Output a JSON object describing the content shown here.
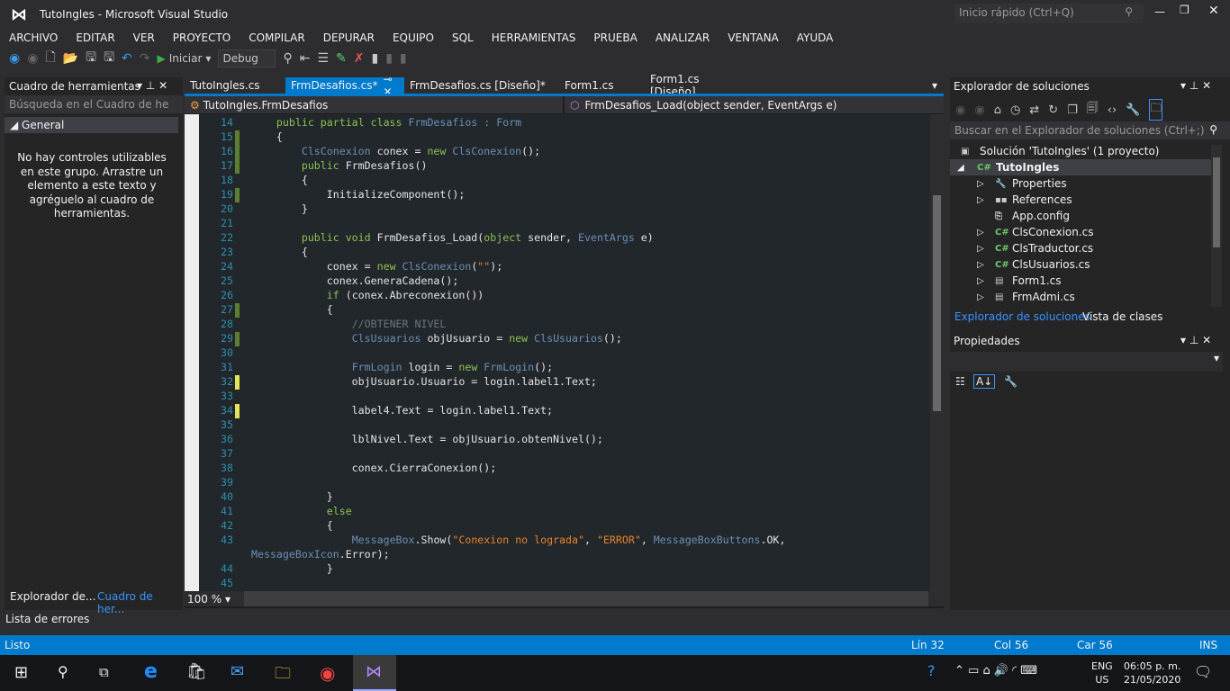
{
  "window": {
    "title": "TutoIngles - Microsoft Visual Studio",
    "quick_launch": "Inicio rápido (Ctrl+Q)"
  },
  "menu": [
    "ARCHIVO",
    "EDITAR",
    "VER",
    "PROYECTO",
    "COMPILAR",
    "DEPURAR",
    "EQUIPO",
    "SQL",
    "HERRAMIENTAS",
    "PRUEBA",
    "ANALIZAR",
    "VENTANA",
    "AYUDA"
  ],
  "toolbar": {
    "start_label": "Iniciar",
    "config": "Debug"
  },
  "toolbox": {
    "title": "Cuadro de herramientas",
    "search_placeholder": "Búsqueda en el Cuadro de he",
    "group": "General",
    "empty_message": "No hay controles utilizables en este grupo. Arrastre un elemento a este texto y agréguelo al cuadro de herramientas.",
    "bottom_tabs": [
      "Explorador de...",
      "Cuadro de her..."
    ]
  },
  "editor": {
    "tabs": [
      "TutoIngles.cs",
      "FrmDesafios.cs*",
      "FrmDesafios.cs [Diseño]*",
      "Form1.cs",
      "Form1.cs [Diseño]"
    ],
    "active_tab": 1,
    "nav_class": "TutoIngles.FrmDesafios",
    "nav_member": "FrmDesafios_Load(object sender, EventArgs e)",
    "zoom": "100 %",
    "lines": [
      {
        "n": "14",
        "tk": [
          [
            "    ",
            "p"
          ],
          [
            "public partial class ",
            "k"
          ],
          [
            "FrmDesafios : Form",
            "t"
          ]
        ]
      },
      {
        "n": "15",
        "tk": [
          [
            "    {",
            "p"
          ]
        ],
        "m": "g"
      },
      {
        "n": "16",
        "tk": [
          [
            "        ",
            "p"
          ],
          [
            "ClsConexion",
            "t"
          ],
          [
            " conex = ",
            "p"
          ],
          [
            "new ",
            "k"
          ],
          [
            "ClsConexion",
            "t"
          ],
          [
            "();",
            "p"
          ]
        ],
        "m": "g"
      },
      {
        "n": "17",
        "tk": [
          [
            "        ",
            "p"
          ],
          [
            "public ",
            "k"
          ],
          [
            "FrmDesafios()",
            "p"
          ]
        ],
        "m": "g"
      },
      {
        "n": "18",
        "tk": [
          [
            "        {",
            "p"
          ]
        ]
      },
      {
        "n": "19",
        "tk": [
          [
            "            InitializeComponent();",
            "p"
          ]
        ],
        "m": "g"
      },
      {
        "n": "20",
        "tk": [
          [
            "        }",
            "p"
          ]
        ]
      },
      {
        "n": "21",
        "tk": []
      },
      {
        "n": "22",
        "tk": [
          [
            "        ",
            "p"
          ],
          [
            "public void ",
            "k"
          ],
          [
            "FrmDesafios_Load(",
            "p"
          ],
          [
            "object ",
            "k"
          ],
          [
            "sender, ",
            "p"
          ],
          [
            "EventArgs",
            "t"
          ],
          [
            " e)",
            "p"
          ]
        ]
      },
      {
        "n": "23",
        "tk": [
          [
            "        {",
            "p"
          ]
        ]
      },
      {
        "n": "24",
        "tk": [
          [
            "            conex = ",
            "p"
          ],
          [
            "new ",
            "k"
          ],
          [
            "ClsConexion",
            "t"
          ],
          [
            "(",
            "p"
          ],
          [
            "\"\"",
            "s"
          ],
          [
            ");",
            "p"
          ]
        ]
      },
      {
        "n": "25",
        "tk": [
          [
            "            conex.GeneraCadena();",
            "p"
          ]
        ]
      },
      {
        "n": "26",
        "tk": [
          [
            "            ",
            "p"
          ],
          [
            "if ",
            "k"
          ],
          [
            "(conex.Abreconexion())",
            "p"
          ]
        ]
      },
      {
        "n": "27",
        "tk": [
          [
            "            {",
            "p"
          ]
        ],
        "m": "g"
      },
      {
        "n": "28",
        "tk": [
          [
            "                ",
            "p"
          ],
          [
            "//OBTENER NIVEL",
            "c"
          ]
        ]
      },
      {
        "n": "29",
        "tk": [
          [
            "                ",
            "p"
          ],
          [
            "ClsUsuarios",
            "t"
          ],
          [
            " objUsuario = ",
            "p"
          ],
          [
            "new ",
            "k"
          ],
          [
            "ClsUsuarios",
            "t"
          ],
          [
            "();",
            "p"
          ]
        ],
        "m": "g"
      },
      {
        "n": "30",
        "tk": []
      },
      {
        "n": "31",
        "tk": [
          [
            "                ",
            "p"
          ],
          [
            "FrmLogin",
            "t"
          ],
          [
            " login = ",
            "p"
          ],
          [
            "new ",
            "k"
          ],
          [
            "FrmLogin",
            "t"
          ],
          [
            "();",
            "p"
          ]
        ]
      },
      {
        "n": "32",
        "tk": [
          [
            "                objUsuario.Usuario = login.label1.Text;",
            "p"
          ]
        ],
        "m": "y"
      },
      {
        "n": "33",
        "tk": []
      },
      {
        "n": "34",
        "tk": [
          [
            "                label4.Text = login.label1.Text;",
            "p"
          ]
        ],
        "m": "y"
      },
      {
        "n": "35",
        "tk": []
      },
      {
        "n": "36",
        "tk": [
          [
            "                lblNivel.Text = objUsuario.obtenNivel();",
            "p"
          ]
        ]
      },
      {
        "n": "37",
        "tk": []
      },
      {
        "n": "38",
        "tk": [
          [
            "                conex.CierraConexion();",
            "p"
          ]
        ]
      },
      {
        "n": "39",
        "tk": []
      },
      {
        "n": "40",
        "tk": [
          [
            "            }",
            "p"
          ]
        ]
      },
      {
        "n": "41",
        "tk": [
          [
            "            ",
            "p"
          ],
          [
            "else",
            "k"
          ]
        ]
      },
      {
        "n": "42",
        "tk": [
          [
            "            {",
            "p"
          ]
        ]
      },
      {
        "n": "43",
        "tk": [
          [
            "                ",
            "p"
          ],
          [
            "MessageBox",
            "t"
          ],
          [
            ".Show(",
            "p"
          ],
          [
            "\"Conexion no lograda\"",
            "s"
          ],
          [
            ", ",
            "p"
          ],
          [
            "\"ERROR\"",
            "s"
          ],
          [
            ", ",
            "p"
          ],
          [
            "MessageBoxButtons",
            "t"
          ],
          [
            ".OK,",
            "p"
          ]
        ]
      },
      {
        "n": "",
        "tk": [
          [
            "MessageBoxIcon",
            "t"
          ],
          [
            ".Error);",
            "p"
          ]
        ],
        "wrap": true
      },
      {
        "n": "44",
        "tk": [
          [
            "            }",
            "p"
          ]
        ]
      },
      {
        "n": "45",
        "tk": []
      }
    ]
  },
  "solution_explorer": {
    "title": "Explorador de soluciones",
    "search_placeholder": "Buscar en el Explorador de soluciones (Ctrl+;)",
    "items": [
      {
        "label": "Solución 'TutoIngles'  (1 proyecto)",
        "level": 0,
        "icon": "solution-icon",
        "exp": ""
      },
      {
        "label": "TutoIngles",
        "level": 1,
        "icon": "csharp-project-icon",
        "exp": "◢",
        "bold": true
      },
      {
        "label": "Properties",
        "level": 2,
        "icon": "wrench-icon",
        "exp": "▷"
      },
      {
        "label": "References",
        "level": 2,
        "icon": "references-icon",
        "exp": "▷"
      },
      {
        "label": "App.config",
        "level": 2,
        "icon": "config-file-icon",
        "exp": ""
      },
      {
        "label": "ClsConexion.cs",
        "level": 2,
        "icon": "csharp-file-icon",
        "exp": "▷"
      },
      {
        "label": "ClsTraductor.cs",
        "level": 2,
        "icon": "csharp-file-icon",
        "exp": "▷"
      },
      {
        "label": "ClsUsuarios.cs",
        "level": 2,
        "icon": "csharp-file-icon",
        "exp": "▷"
      },
      {
        "label": "Form1.cs",
        "level": 2,
        "icon": "form-file-icon",
        "exp": "▷"
      },
      {
        "label": "FrmAdmi.cs",
        "level": 2,
        "icon": "form-file-icon",
        "exp": "▷"
      }
    ],
    "bottom_tabs": [
      "Explorador de soluciones",
      "Vista de clases"
    ]
  },
  "properties": {
    "title": "Propiedades"
  },
  "error_list": {
    "title": "Lista de errores"
  },
  "status": {
    "text": "Listo",
    "line": "Lín 32",
    "col": "Col 56",
    "char": "Car 56",
    "mode": "INS"
  },
  "taskbar": {
    "lang1": "ENG",
    "lang2": "US",
    "time": "06:05 p. m.",
    "date": "21/05/2020"
  },
  "colors": {
    "accent": "#007acc",
    "keyword": "#8cc152",
    "type": "#6a8fb5",
    "string": "#e8822a",
    "comment": "#6b757d",
    "line_number": "#2b91af",
    "change_saved": "#5b7f2e",
    "change_unsaved": "#e4e45a"
  }
}
